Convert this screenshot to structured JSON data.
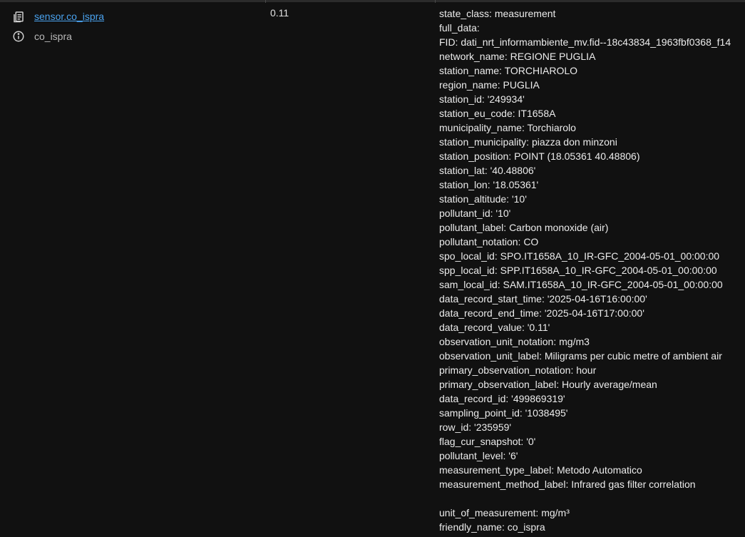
{
  "entity": {
    "entity_id": "sensor.co_ispra",
    "friendly_name": "co_ispra",
    "state": "0.11"
  },
  "attributes": [
    "state_class: measurement",
    "full_data:",
    "FID: dati_nrt_informambiente_mv.fid--18c43834_1963fbf0368_f14",
    "network_name: REGIONE PUGLIA",
    "station_name: TORCHIAROLO",
    "region_name: PUGLIA",
    "station_id: '249934'",
    "station_eu_code: IT1658A",
    "municipality_name: Torchiarolo",
    "station_municipality: piazza don minzoni",
    "station_position: POINT (18.05361 40.48806)",
    "station_lat: '40.48806'",
    "station_lon: '18.05361'",
    "station_altitude: '10'",
    "pollutant_id: '10'",
    "pollutant_label: Carbon monoxide (air)",
    "pollutant_notation: CO",
    "spo_local_id: SPO.IT1658A_10_IR-GFC_2004-05-01_00:00:00",
    "spp_local_id: SPP.IT1658A_10_IR-GFC_2004-05-01_00:00:00",
    "sam_local_id: SAM.IT1658A_10_IR-GFC_2004-05-01_00:00:00",
    "data_record_start_time: '2025-04-16T16:00:00'",
    "data_record_end_time: '2025-04-16T17:00:00'",
    "data_record_value: '0.11'",
    "observation_unit_notation: mg/m3",
    "observation_unit_label: Miligrams per cubic metre of ambient air",
    "primary_observation_notation: hour",
    "primary_observation_label: Hourly average/mean",
    "data_record_id: '499869319'",
    "sampling_point_id: '1038495'",
    "row_id: '235959'",
    "flag_cur_snapshot: '0'",
    "pollutant_level: '6'",
    "measurement_type_label: Metodo Automatico",
    "measurement_method_label: Infrared gas filter correlation",
    "",
    "unit_of_measurement: mg/m³",
    "friendly_name: co_ispra"
  ],
  "icons": {
    "entity_icon": "clipboard-list-icon",
    "info_icon": "information-outline-icon"
  }
}
